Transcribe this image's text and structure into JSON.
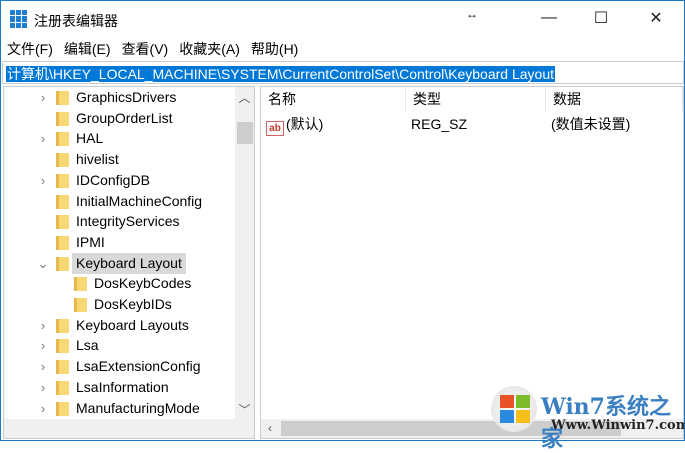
{
  "window": {
    "title": "注册表编辑器",
    "resize_glyph": "↔",
    "minimize": "—",
    "maximize": "☐",
    "close": "✕"
  },
  "menu": [
    "文件(F)",
    "编辑(E)",
    "查看(V)",
    "收藏夹(A)",
    "帮助(H)"
  ],
  "address": "计算机\\HKEY_LOCAL_MACHINE\\SYSTEM\\CurrentControlSet\\Control\\Keyboard Layout",
  "tree": [
    {
      "label": "GraphicsDrivers",
      "expander": "collapsed",
      "level": 0
    },
    {
      "label": "GroupOrderList",
      "expander": "none",
      "level": 0
    },
    {
      "label": "HAL",
      "expander": "collapsed",
      "level": 0
    },
    {
      "label": "hivelist",
      "expander": "none",
      "level": 0
    },
    {
      "label": "IDConfigDB",
      "expander": "collapsed",
      "level": 0
    },
    {
      "label": "InitialMachineConfig",
      "expander": "none",
      "level": 0
    },
    {
      "label": "IntegrityServices",
      "expander": "none",
      "level": 0
    },
    {
      "label": "IPMI",
      "expander": "none",
      "level": 0
    },
    {
      "label": "Keyboard Layout",
      "expander": "expanded",
      "level": 0,
      "selected": true
    },
    {
      "label": "DosKeybCodes",
      "expander": "none",
      "level": 1
    },
    {
      "label": "DosKeybIDs",
      "expander": "none",
      "level": 1
    },
    {
      "label": "Keyboard Layouts",
      "expander": "collapsed",
      "level": 0
    },
    {
      "label": "Lsa",
      "expander": "collapsed",
      "level": 0
    },
    {
      "label": "LsaExtensionConfig",
      "expander": "collapsed",
      "level": 0
    },
    {
      "label": "LsaInformation",
      "expander": "collapsed",
      "level": 0
    },
    {
      "label": "ManufacturingMode",
      "expander": "collapsed",
      "level": 0
    }
  ],
  "columns": [
    "名称",
    "类型",
    "数据"
  ],
  "values": [
    {
      "name": "(默认)",
      "type": "REG_SZ",
      "data": "(数值未设置)",
      "icon": "ab"
    }
  ],
  "watermark": {
    "brand": "Win7系统之家",
    "url": "Www.Winwin7.com"
  }
}
